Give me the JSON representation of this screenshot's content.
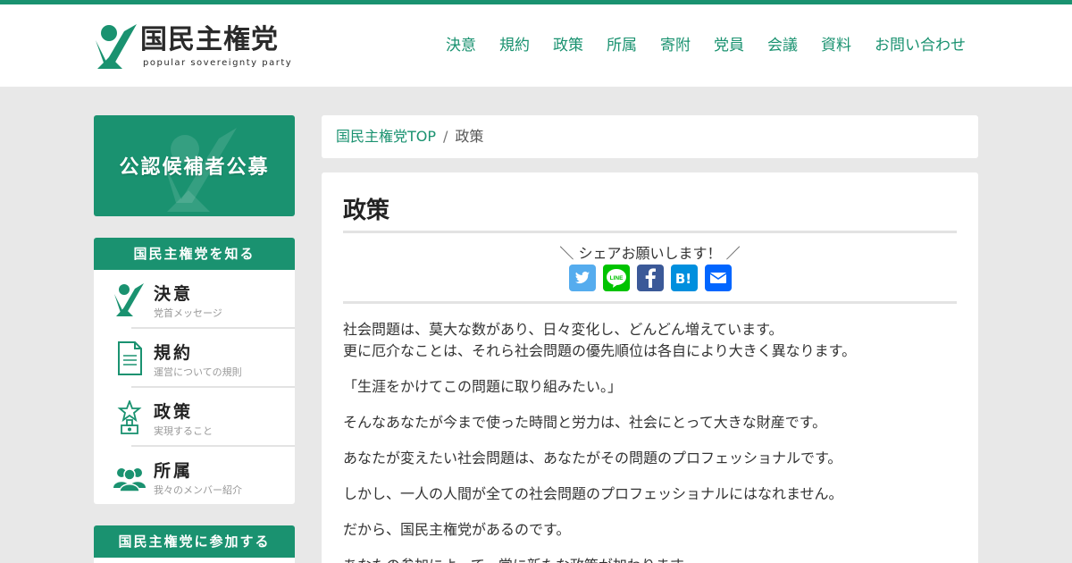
{
  "header": {
    "logo_name": "国民主権党",
    "logo_sub": "popular sovereignty party",
    "nav": [
      "決意",
      "規約",
      "政策",
      "所属",
      "寄附",
      "党員",
      "会議",
      "資料",
      "お問い合わせ"
    ]
  },
  "sidebar": {
    "banner_text": "公認候補者公募",
    "know_heading": "国民主権党を知る",
    "items": [
      {
        "title": "決意",
        "desc": "党首メッセージ",
        "icon": "leader-check-icon"
      },
      {
        "title": "規約",
        "desc": "運営についての規則",
        "icon": "document-icon"
      },
      {
        "title": "政策",
        "desc": "実現すること",
        "icon": "trophy-star-icon"
      },
      {
        "title": "所属",
        "desc": "我々のメンバー紹介",
        "icon": "members-icon"
      }
    ],
    "join_heading": "国民主権党に参加する"
  },
  "breadcrumb": {
    "home": "国民主権党TOP",
    "separator": "/",
    "current": "政策"
  },
  "main": {
    "title": "政策",
    "share_text": "＼ シェアお願いします！ ／",
    "share_buttons": [
      {
        "name": "twitter-icon",
        "color": "#55acee"
      },
      {
        "name": "line-icon",
        "color": "#00c300"
      },
      {
        "name": "facebook-icon",
        "color": "#3b5998"
      },
      {
        "name": "hatena-icon",
        "color": "#008fde"
      },
      {
        "name": "mail-icon",
        "color": "#0166ff"
      }
    ],
    "paragraphs": [
      "社会問題は、莫大な数があり、日々変化し、どんどん増えています。",
      "更に厄介なことは、それら社会問題の優先順位は各自により大きく異なります。",
      "「生涯をかけてこの問題に取り組みたい。」",
      "そんなあなたが今まで使った時間と労力は、社会にとって大きな財産です。",
      "あなたが変えたい社会問題は、あなたがその問題のプロフェッショナルです。",
      "しかし、一人の人間が全ての社会問題のプロフェッショナルにはなれません。",
      "だから、国民主権党があるのです。",
      "あなたの参加によって、常に新たな政策が加わります。"
    ]
  },
  "colors": {
    "brand": "#1a9270"
  }
}
